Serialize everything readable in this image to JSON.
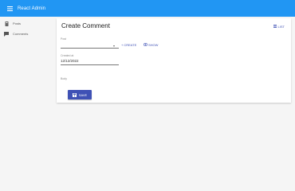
{
  "header": {
    "title": "React Admin",
    "menu_icon": "hamburger-menu-icon",
    "color": "#2196f3"
  },
  "sidebar": {
    "items": [
      {
        "label": "Posts",
        "icon": "book-icon"
      },
      {
        "label": "Comments",
        "icon": "chat-bubble-icon"
      }
    ]
  },
  "main": {
    "title": "Create Comment",
    "list_label": "LIST",
    "form": {
      "post": {
        "label": "Post",
        "value": "",
        "create_label": "CREATE",
        "show_label": "SHOW"
      },
      "created_at": {
        "label": "Created at",
        "value": "12/12/2022"
      },
      "body": {
        "label": "Body",
        "value": ""
      }
    },
    "save_label": "SAVE",
    "accent": "#3f51b5"
  }
}
